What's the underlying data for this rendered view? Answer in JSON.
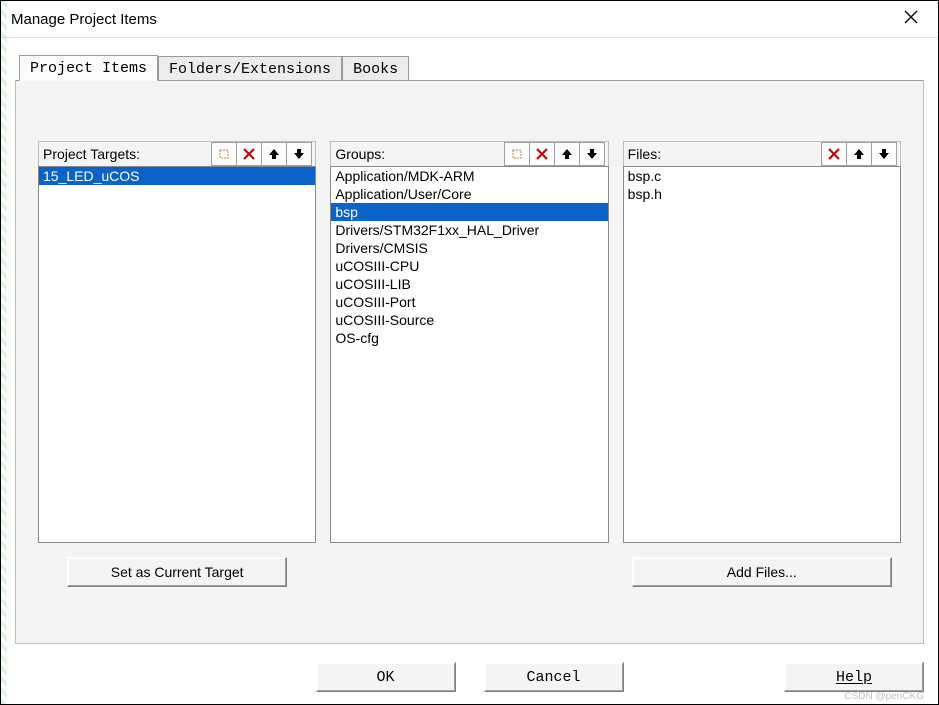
{
  "window": {
    "title": "Manage Project Items"
  },
  "tabs": {
    "items": [
      {
        "label": "Project Items",
        "selected": true
      },
      {
        "label": "Folders/Extensions",
        "selected": false
      },
      {
        "label": "Books",
        "selected": false
      }
    ]
  },
  "columns": {
    "targets": {
      "header": "Project Targets:",
      "toolbar": [
        "new",
        "delete",
        "move-up",
        "move-down"
      ],
      "items": [
        "15_LED_uCOS"
      ],
      "selected_index": 0,
      "button": "Set as Current Target"
    },
    "groups": {
      "header": "Groups:",
      "toolbar": [
        "new",
        "delete",
        "move-up",
        "move-down"
      ],
      "items": [
        "Application/MDK-ARM",
        "Application/User/Core",
        "bsp",
        "Drivers/STM32F1xx_HAL_Driver",
        "Drivers/CMSIS",
        "uCOSIII-CPU",
        "uCOSIII-LIB",
        "uCOSIII-Port",
        "uCOSIII-Source",
        "OS-cfg"
      ],
      "selected_index": 2
    },
    "files": {
      "header": "Files:",
      "toolbar": [
        "delete",
        "move-up",
        "move-down"
      ],
      "items": [
        "bsp.c",
        "bsp.h"
      ],
      "selected_index": -1,
      "button": "Add Files..."
    }
  },
  "footer": {
    "ok": "OK",
    "cancel": "Cancel",
    "help": "Help"
  },
  "watermark": "CSDN @penCKG"
}
